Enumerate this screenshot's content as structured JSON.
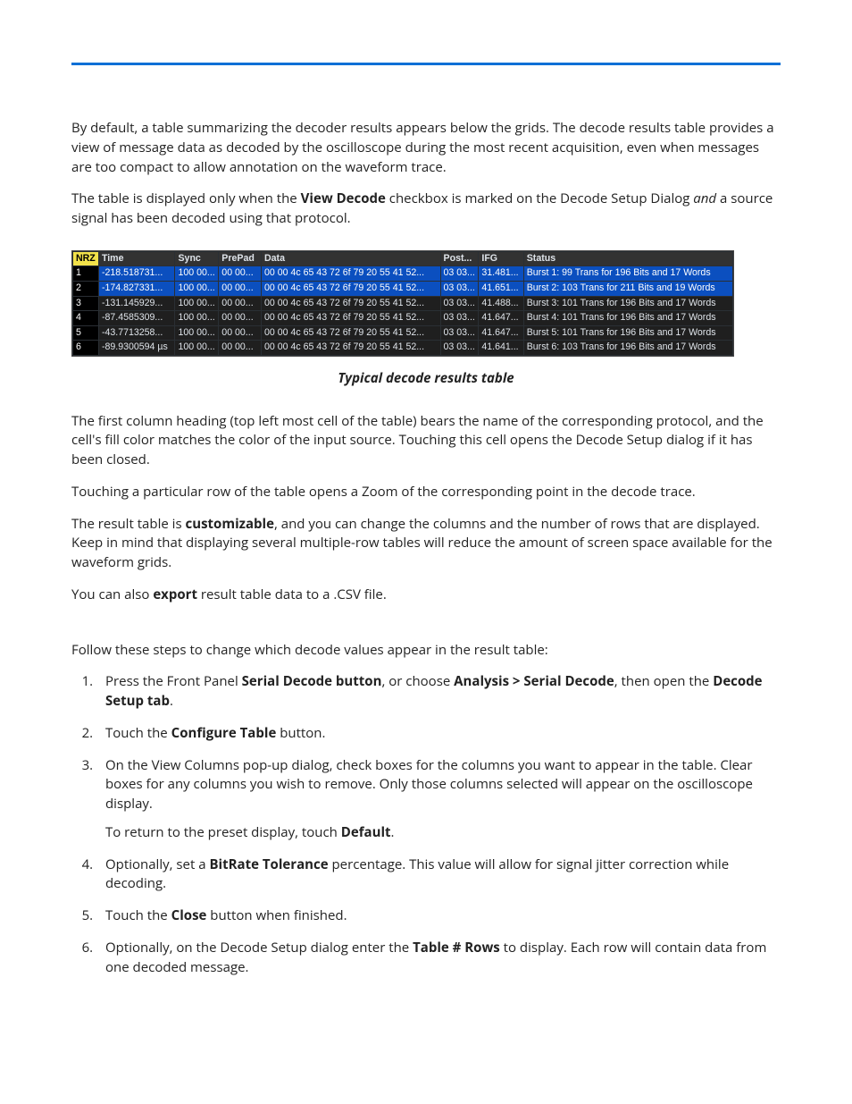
{
  "intro": {
    "p1": "By default, a table summarizing the decoder results appears below the grids. The decode results table provides a view of message data as decoded by the oscilloscope during the most recent acquisition, even when messages are too compact to allow annotation on the waveform trace.",
    "p2a": "The table is displayed only when the ",
    "p2b": "View Decode",
    "p2c": " checkbox is marked on the Decode Setup Dialog ",
    "p2d": "and",
    "p2e": " a source signal has been decoded using that protocol."
  },
  "table": {
    "protocol": "NRZ",
    "headers": [
      "Time",
      "Sync",
      "PrePad",
      "Data",
      "Post...",
      "IFG",
      "Status"
    ],
    "rows": [
      {
        "idx": "1",
        "time": "-218.518731...",
        "sync": "100 00...",
        "prepad": "00 00...",
        "data": "00 00 4c 65 43 72 6f 79 20 55 41 52...",
        "post": "03 03...",
        "ifg": "31.481...",
        "status": "Burst  1:  99 Trans for 196 Bits and 17 Words",
        "sel": true
      },
      {
        "idx": "2",
        "time": "-174.827331...",
        "sync": "100 00...",
        "prepad": "00 00...",
        "data": "00 00 4c 65 43 72 6f 79 20 55 41 52...",
        "post": "03 03...",
        "ifg": "41.651...",
        "status": "Burst  2: 103 Trans for 211 Bits and 19 Words",
        "sel": true
      },
      {
        "idx": "3",
        "time": "-131.145929...",
        "sync": "100 00...",
        "prepad": "00 00...",
        "data": "00 00 4c 65 43 72 6f 79 20 55 41 52...",
        "post": "03 03...",
        "ifg": "41.488...",
        "status": "Burst  3: 101 Trans for 196 Bits and 17 Words",
        "sel": false
      },
      {
        "idx": "4",
        "time": "-87.4585309...",
        "sync": "100 00...",
        "prepad": "00 00...",
        "data": "00 00 4c 65 43 72 6f 79 20 55 41 52...",
        "post": "03 03...",
        "ifg": "41.647...",
        "status": "Burst  4: 101 Trans for 196 Bits and 17 Words",
        "sel": false
      },
      {
        "idx": "5",
        "time": "-43.7713258...",
        "sync": "100 00...",
        "prepad": "00 00...",
        "data": "00 00 4c 65 43 72 6f 79 20 55 41 52...",
        "post": "03 03...",
        "ifg": "41.647...",
        "status": "Burst  5: 101 Trans for 196 Bits and 17 Words",
        "sel": false
      },
      {
        "idx": "6",
        "time": "-89.9300594 µs",
        "sync": "100 00...",
        "prepad": "00 00...",
        "data": "00 00 4c 65 43 72 6f 79 20 55 41 52...",
        "post": "03 03...",
        "ifg": "41.641...",
        "status": "Burst  6: 103 Trans for 196 Bits and 17 Words",
        "sel": false
      }
    ]
  },
  "caption": "Typical decode results table",
  "body": {
    "p3": "The first column heading (top left most cell of the table) bears the name of the corresponding protocol, and the cell's fill color matches the color of the input source. Touching this cell opens the Decode Setup dialog if it has been closed.",
    "p4": "Touching a particular row of the table opens a Zoom of the corresponding point in the decode trace.",
    "p5a": "The result table is ",
    "p5b": "customizable",
    "p5c": ", and you can change the columns and the number of rows that are displayed. Keep in mind that displaying several multiple-row tables will reduce the amount of screen space available for the waveform grids.",
    "p6a": "You can also ",
    "p6b": "export",
    "p6c": " result table data to a .CSV file.",
    "lead": "Follow these steps to change which decode values appear in the result table:"
  },
  "steps": {
    "s1a": "Press the Front Panel ",
    "s1b": "Serial Decode button",
    "s1c": ", or choose ",
    "s1d": "Analysis > Serial Decode",
    "s1e": ", then open the ",
    "s1f": "Decode Setup tab",
    "s1g": ".",
    "s2a": "Touch the ",
    "s2b": "Configure Table",
    "s2c": " button.",
    "s3": "On the View Columns pop-up dialog, check boxes for the columns you want to appear in the table. Clear boxes for any columns you wish to remove. Only those columns selected will appear on the oscilloscope display.",
    "s3sub_a": "To return to the preset display, touch ",
    "s3sub_b": "Default",
    "s3sub_c": ".",
    "s4a": "Optionally, set a ",
    "s4b": "BitRate Tolerance",
    "s4c": " percentage. This value will allow for signal jitter correction while decoding.",
    "s5a": "Touch the ",
    "s5b": "Close",
    "s5c": " button when finished.",
    "s6a": "Optionally, on the Decode Setup dialog enter the ",
    "s6b": "Table # Rows",
    "s6c": " to display. Each row will contain data from one decoded message."
  }
}
